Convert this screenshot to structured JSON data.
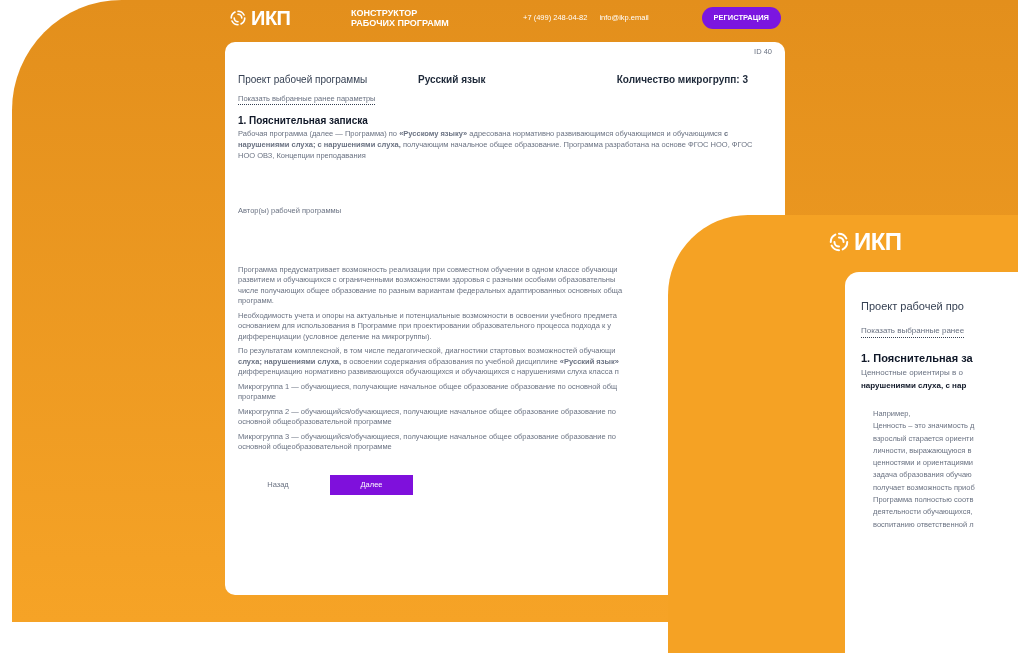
{
  "main_screen": {
    "header": {
      "logo_text": "ИКП",
      "title_lines": [
        "КОНСТРУКТОР",
        "РАБОЧИХ ПРОГРАММ"
      ],
      "phone": "+7 (499) 248-04-82",
      "email": "info@ikp.email",
      "register_button": "РЕГИСТРАЦИЯ"
    },
    "card": {
      "id_label": "ID 40",
      "project_label": "Проект рабочей программы",
      "subject": "Русский язык",
      "microgroups": "Количество микрогрупп: 3",
      "show_params_link": "Показать выбранные ранее параметры",
      "section_title": "1. Пояснительная записка",
      "intro": "Рабочая программа (далее — Программа) по **«Русскому языку»** адресована нормативно развивающимся обучающимся и обучающимся **с нарушениями слуха; с нарушениями слуха,** получающим начальное общее образование. Программа разработана на основе ФГОС НОО, ФГОС НОО ОВЗ, Концепции преподавания",
      "author_label": "Автор(ы) рабочей программы",
      "paragraphs": [
        [
          "Программа предусматривает возможность реализации при совместном обучении в одном классе обучающи",
          "развитием и обучающихся с ограниченными возможностями здоровья с разными особыми образовательны",
          "числе получающих общее образование по разным вариантам федеральных адаптированных основных обща",
          "программ."
        ],
        [
          "Необходимость учета и опоры на актуальные и потенциальные возможности в освоении учебного предмета",
          "основанием для использования в Программе при проектировании образовательного процесса подхода к у",
          "дифференциации (условное деление на микрогруппы)."
        ],
        [
          "По результатам комплексной, в том числе педагогической, диагностики стартовых возможностей обучающи",
          "**слуха; нарушениями слуха,** в освоении содержания образования по учебной дисциплине **«Русский язык»**",
          "дифференциацию нормативно развивающихся обучающихся и обучающихся с нарушениями слуха класса п"
        ],
        [
          "Микрогруппа 1 — обучающиеся, получающие начальное общее образование образование по основной общ",
          "программе"
        ],
        [
          "Микрогруппа 2 — обучающийся/обучающиеся, получающие начальное общее образование образование по",
          "основной общеобразовательной программе"
        ],
        [
          "Микрогруппа 3 — обучающийся/обучающиеся, получающие начальное общее образование образование по",
          "основной общеобразовательной программе"
        ]
      ],
      "buttons": {
        "back": "Назад",
        "next": "Далее"
      }
    }
  },
  "second_screen": {
    "logo_text": "ИКП",
    "project_label": "Проект рабочей про",
    "show_params_link": "Показать выбранные ранее",
    "section_title": "1. Пояснительная за",
    "intro_lines": [
      {
        "text": "Ценностные ориентиры в о",
        "bold": false
      },
      {
        "text": "нарушениями слуха, с нар",
        "bold": true
      }
    ],
    "example_lines": [
      "Например,",
      "Ценность – это значимость д",
      "взрослый старается ориенти",
      "личности, выражающуюся в",
      "ценностями и ориентациями",
      "задача образования обучаю",
      "получает возможность приоб",
      "Программа полностью соотв",
      "деятельности обучающихся,",
      "воспитанию ответственной л"
    ]
  }
}
